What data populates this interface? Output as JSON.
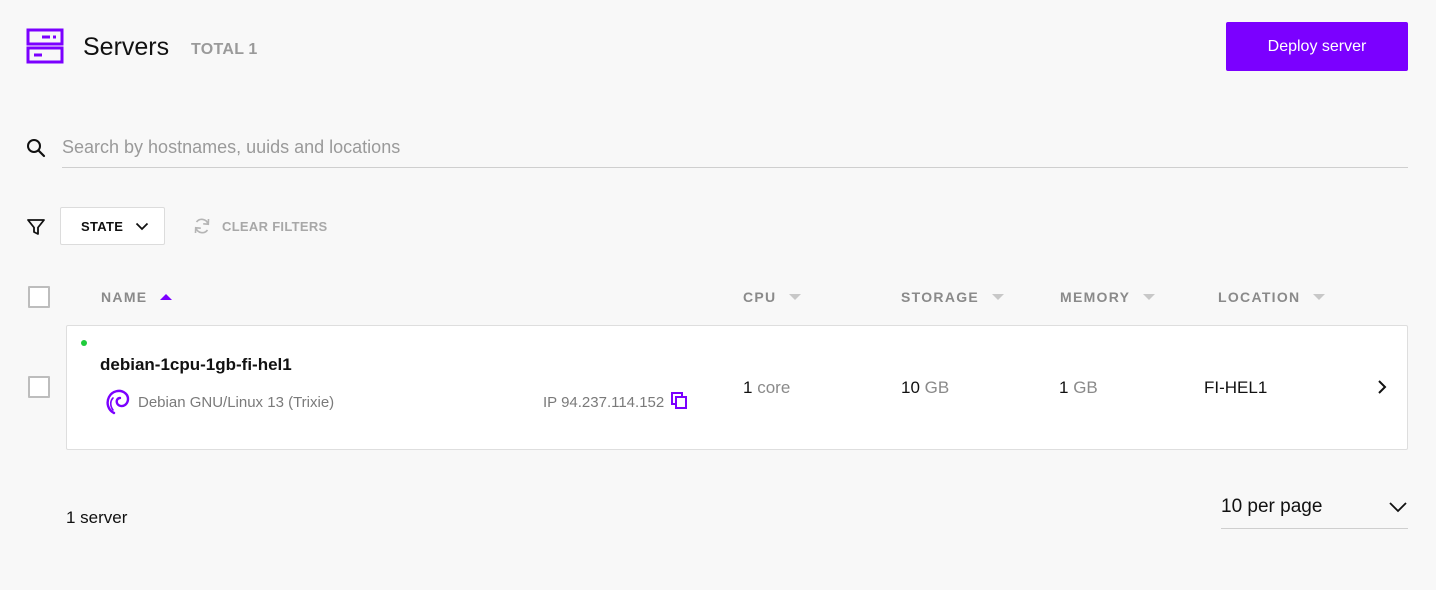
{
  "header": {
    "title": "Servers",
    "total_label": "TOTAL",
    "total_count": "1",
    "deploy_button": "Deploy server"
  },
  "search": {
    "placeholder": "Search by hostnames, uuids and locations",
    "value": ""
  },
  "filters": {
    "state_label": "STATE",
    "clear_label": "CLEAR FILTERS"
  },
  "table": {
    "columns": [
      {
        "label": "NAME",
        "sort": "ascending"
      },
      {
        "label": "CPU",
        "sort": "none"
      },
      {
        "label": "STORAGE",
        "sort": "none"
      },
      {
        "label": "MEMORY",
        "sort": "none"
      },
      {
        "label": "LOCATION",
        "sort": "none"
      }
    ],
    "rows": [
      {
        "hostname": "debian-1cpu-1gb-fi-hel1",
        "status": "running",
        "os": "Debian GNU/Linux 13 (Trixie)",
        "ip": "IP 94.237.114.152",
        "cpu_value": "1",
        "cpu_unit": "core",
        "storage_value": "10",
        "storage_unit": "GB",
        "memory_value": "1",
        "memory_unit": "GB",
        "location": "FI-HEL1"
      }
    ]
  },
  "footer": {
    "count_text": "1 server",
    "per_page": "10 per page"
  },
  "colors": {
    "accent": "#7b00ff",
    "status_running": "#1fcc3b"
  },
  "icons": [
    "servers-icon",
    "search-icon",
    "filter-icon",
    "chevron-down-icon",
    "refresh-icon",
    "sort-arrow-icon",
    "debian-logo-icon",
    "copy-icon",
    "chevron-right-icon"
  ]
}
